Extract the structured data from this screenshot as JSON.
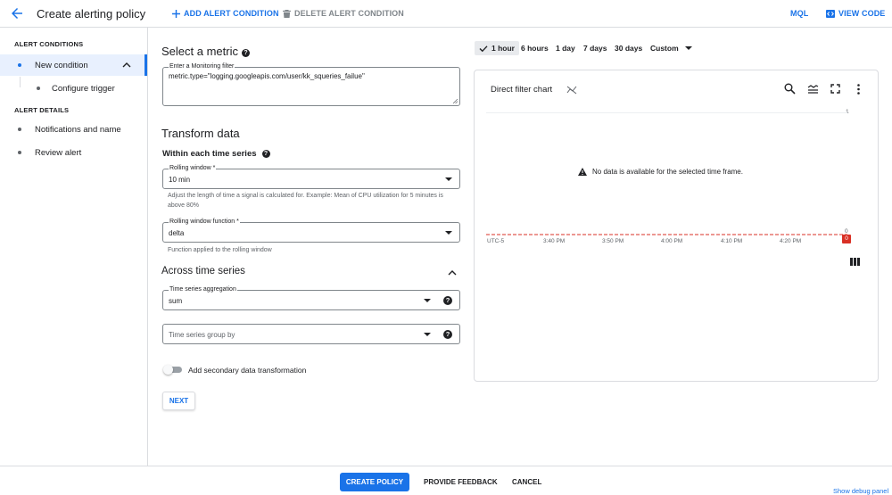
{
  "header": {
    "title": "Create alerting policy",
    "add_condition": "ADD ALERT CONDITION",
    "delete_condition": "DELETE ALERT CONDITION",
    "mql": "MQL",
    "view_code": "VIEW CODE"
  },
  "sidebar": {
    "alert_conditions_heading": "ALERT CONDITIONS",
    "new_condition": "New condition",
    "configure_trigger": "Configure trigger",
    "alert_details_heading": "ALERT DETAILS",
    "notifications": "Notifications and name",
    "review": "Review alert"
  },
  "form": {
    "select_metric": "Select a metric",
    "filter_label": "Enter a Monitoring filter",
    "filter_value": "metric.type=\"logging.googleapis.com/user/kk_squeries_failue\"",
    "transform_data": "Transform data",
    "within_each": "Within each time series",
    "rolling_window_label": "Rolling window *",
    "rolling_window_value": "10 min",
    "rolling_window_hint": "Adjust the length of time a signal is calculated for. Example: Mean of CPU utilization for 5 minutes is above 80%",
    "rolling_fn_label": "Rolling window function *",
    "rolling_fn_value": "delta",
    "rolling_fn_hint": "Function applied to the rolling window",
    "across": "Across time series",
    "aggregation_label": "Time series aggregation",
    "aggregation_value": "sum",
    "group_by_placeholder": "Time series group by",
    "secondary_toggle": "Add secondary data transformation",
    "next": "NEXT"
  },
  "time_range": {
    "options": [
      "1 hour",
      "6 hours",
      "1 day",
      "7 days",
      "30 days",
      "Custom"
    ],
    "selected": "1 hour"
  },
  "chart": {
    "title": "Direct filter chart",
    "no_data": "No data is available for the selected time frame.",
    "y_top": "1",
    "y_bottom": "0",
    "badge": "0",
    "timezone": "UTC-5",
    "ticks": [
      "3:40 PM",
      "3:50 PM",
      "4:00 PM",
      "4:10 PM",
      "4:20 PM"
    ]
  },
  "footer": {
    "create_policy": "CREATE POLICY",
    "feedback": "PROVIDE FEEDBACK",
    "cancel": "CANCEL",
    "debug": "Show debug panel"
  },
  "colors": {
    "accent": "#1a73e8",
    "threshold": "#d93025",
    "border": "#dadce0"
  }
}
